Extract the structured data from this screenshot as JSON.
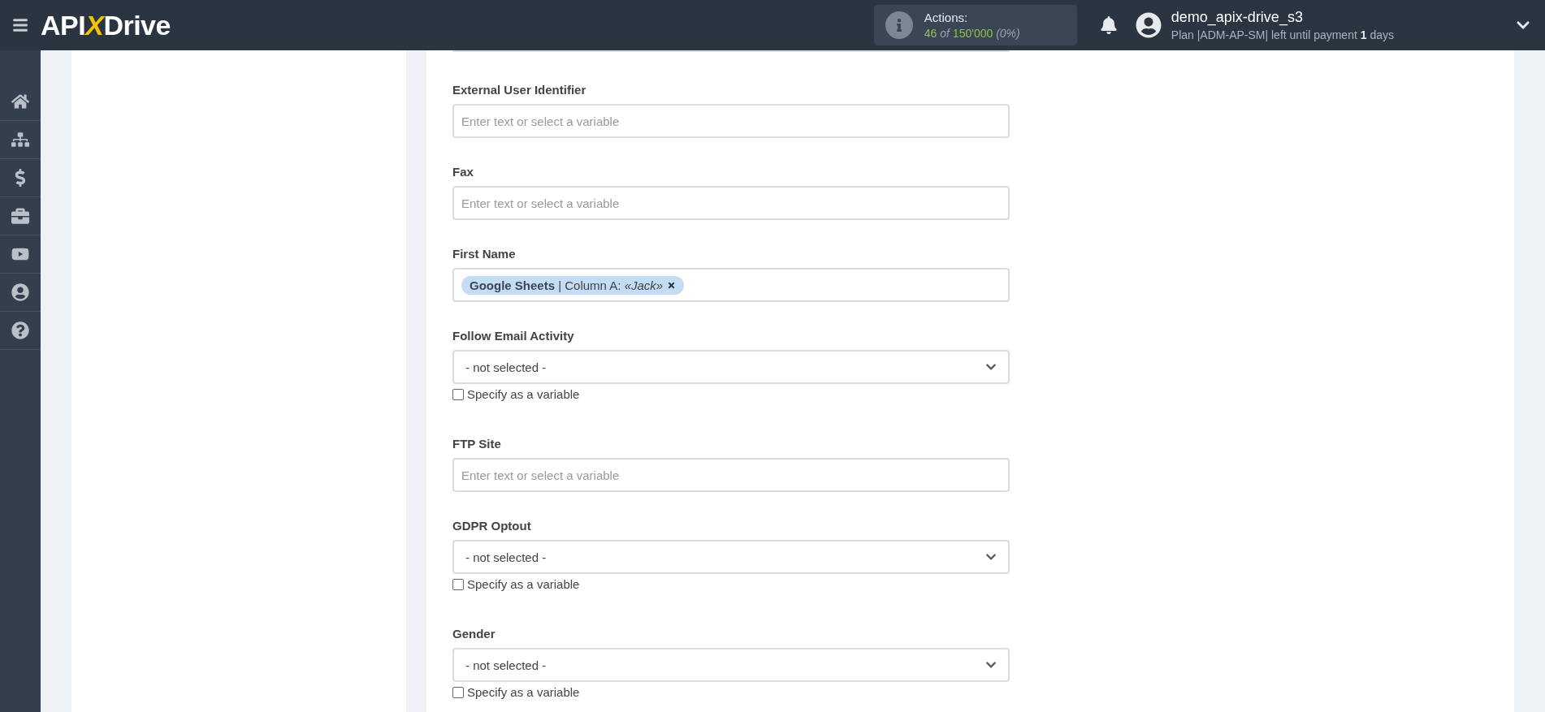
{
  "header": {
    "logo": {
      "prefix": "API",
      "x": "X",
      "suffix": "Drive"
    },
    "actions": {
      "label": "Actions:",
      "used": "46",
      "of": "of",
      "total": "150'000",
      "percent": "(0%)"
    },
    "user": {
      "name": "demo_apix-drive_s3",
      "plan": "Plan |ADM-AP-SM| left until payment **1** days"
    }
  },
  "sidebar": {
    "items": [
      {
        "selected": false
      },
      {
        "selected": false
      },
      {
        "selected": false
      },
      {
        "selected": false
      },
      {
        "selected": false
      },
      {
        "selected": false
      },
      {
        "selected": false
      }
    ]
  },
  "form": {
    "fields": [
      {
        "kind": "text",
        "label": "External User Identifier",
        "placeholder": "Enter text or select a variable"
      },
      {
        "kind": "text",
        "label": "Fax",
        "placeholder": "Enter text or select a variable"
      },
      {
        "kind": "tags",
        "label": "First Name",
        "tags": [
          "**Google Sheets** | Column A: *«Jack»*"
        ]
      },
      {
        "kind": "select",
        "label": "Follow Email Activity",
        "value": "- not selected -",
        "checkbox": {
          "label": "Specify as a variable",
          "checked": false
        }
      },
      {
        "kind": "text",
        "label": "FTP Site",
        "placeholder": "Enter text or select a variable"
      },
      {
        "kind": "select",
        "label": "GDPR Optout",
        "value": "- not selected -",
        "checkbox": {
          "label": "Specify as a variable",
          "checked": false
        }
      },
      {
        "kind": "select",
        "label": "Gender",
        "value": "- not selected -",
        "checkbox": {
          "label": "Specify as a variable",
          "checked": false
        }
      }
    ]
  }
}
